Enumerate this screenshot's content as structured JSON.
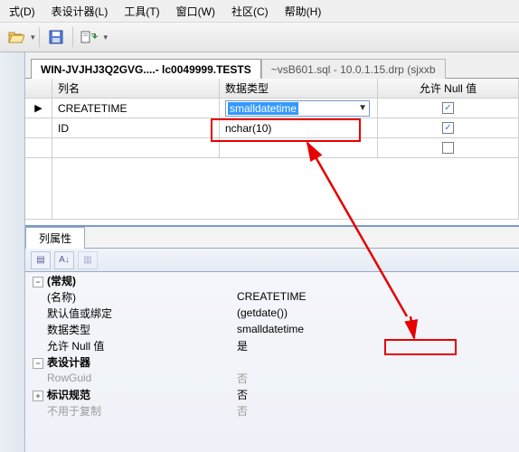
{
  "menu": {
    "items": [
      {
        "label": "式(D)"
      },
      {
        "label": "表设计器(L)"
      },
      {
        "label": "工具(T)"
      },
      {
        "label": "窗口(W)"
      },
      {
        "label": "社区(C)"
      },
      {
        "label": "帮助(H)"
      }
    ]
  },
  "toolbar": {
    "icons": [
      "folder-open-icon",
      "save-icon",
      "change-type-icon"
    ]
  },
  "tabs": {
    "active": "WIN-JVJHJ3Q2GVG....- lc0049999.TESTS",
    "inactive": "~vsB601.sql - 10.0.1.15.drp (sjxxb"
  },
  "grid": {
    "headers": {
      "name": "列名",
      "type": "数据类型",
      "null": "允许 Null 值"
    },
    "rows": [
      {
        "indicator": "▶",
        "name": "CREATETIME",
        "type_display": "smalldatetime",
        "is_combo": true,
        "allow_null": true
      },
      {
        "indicator": "",
        "name": "ID",
        "type_display": "nchar(10)",
        "is_combo": false,
        "allow_null": true
      }
    ],
    "empty_null": false
  },
  "prop": {
    "tab_label": "列属性",
    "groups": [
      {
        "name": "(常规)",
        "items": [
          {
            "k": "(名称)",
            "v": "CREATETIME"
          },
          {
            "k": "默认值或绑定",
            "v": "(getdate())",
            "highlight": true
          },
          {
            "k": "数据类型",
            "v": "smalldatetime"
          },
          {
            "k": "允许 Null 值",
            "v": "是"
          }
        ]
      },
      {
        "name": "表设计器",
        "items": [
          {
            "k": "RowGuid",
            "v": "否",
            "dim": true
          },
          {
            "k": "标识规范",
            "v": "否",
            "expandable": true
          },
          {
            "k": "不用于复制",
            "v": "否",
            "dim": true
          }
        ]
      }
    ]
  },
  "annotations": {
    "highlight_color": "#e60000"
  },
  "chart_data": null
}
